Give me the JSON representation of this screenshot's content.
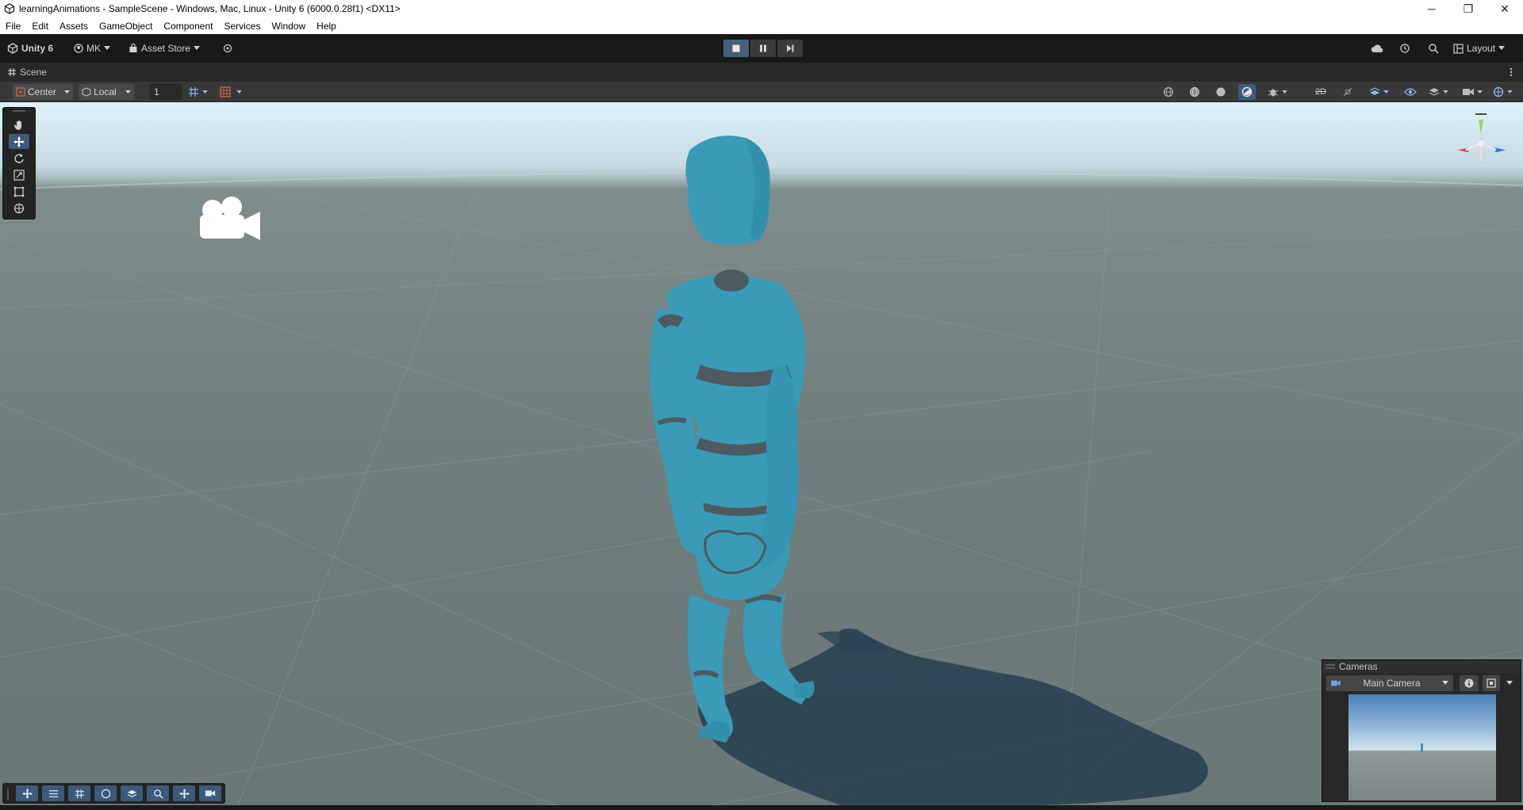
{
  "window": {
    "title": "learningAnimations - SampleScene - Windows, Mac, Linux - Unity 6 (6000.0.28f1) <DX11>",
    "minimize_glyph": "─",
    "maximize_glyph": "❐",
    "close_glyph": "✕"
  },
  "menu": [
    "File",
    "Edit",
    "Assets",
    "GameObject",
    "Component",
    "Services",
    "Window",
    "Help"
  ],
  "toolbar": {
    "unity_label": "Unity 6",
    "account_label": "MK",
    "asset_store_label": "Asset Store",
    "layout_label": "Layout"
  },
  "scene_tab": {
    "label": "Scene"
  },
  "scene_toolbar": {
    "pivot_label": "Center",
    "space_label": "Local",
    "grid_value": "1",
    "mode_2d_label": "2D"
  },
  "tools": [
    "hand-tool",
    "move-tool",
    "rotate-tool",
    "scale-tool",
    "rect-tool",
    "transform-tool"
  ],
  "cameras_overlay": {
    "title": "Cameras",
    "selected_camera": "Main Camera"
  },
  "colors": {
    "accent": "#3d5a7a",
    "character": "#3a9ab8",
    "character_joint": "#4d5a62",
    "shadow": "#2c3e50"
  }
}
